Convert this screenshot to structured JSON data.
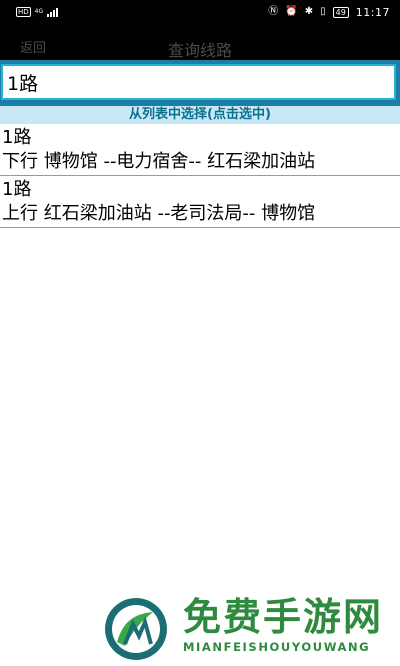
{
  "statusbar": {
    "hd": "HD",
    "net_type": "4G",
    "battery": "49",
    "time": "11:17"
  },
  "header": {
    "back_label": "返回",
    "title": "查询线路"
  },
  "search": {
    "value": "1路"
  },
  "hint": "从列表中选择(点击选中)",
  "routes": [
    {
      "name": "1路",
      "detail": "下行 博物馆 --电力宿舍-- 红石梁加油站"
    },
    {
      "name": "1路",
      "detail": "上行 红石梁加油站 --老司法局-- 博物馆"
    }
  ],
  "watermark": {
    "title": "免费手游网",
    "subtitle": "MIANFEISHOUYOUWANG",
    "colors": {
      "green": "#2e8a3e",
      "teal": "#1b6f74"
    }
  }
}
